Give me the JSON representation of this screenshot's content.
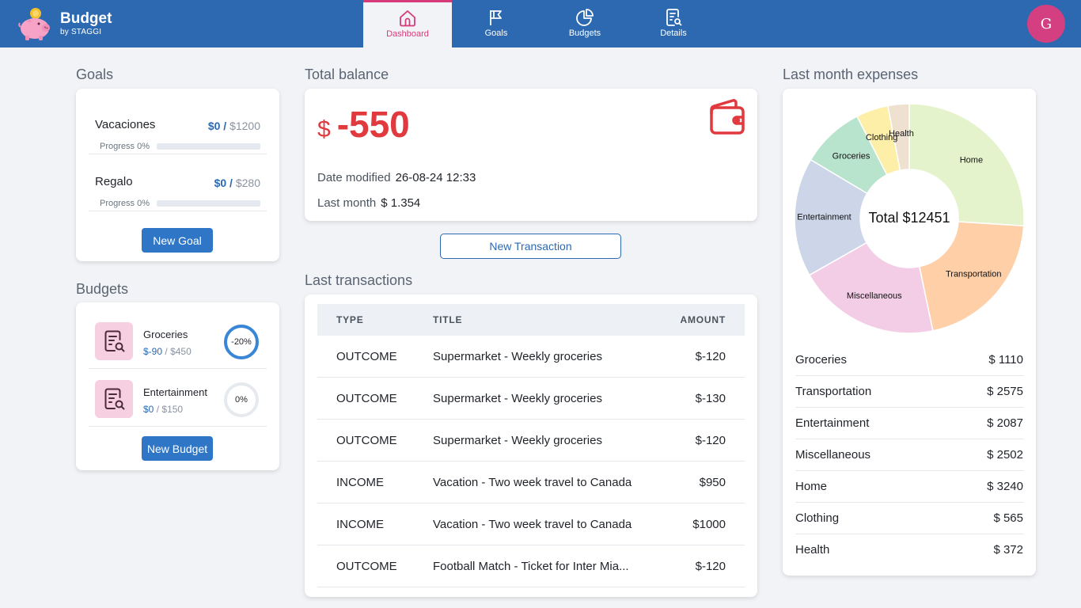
{
  "app": {
    "title": "Budget",
    "subtitle": "by STAGGI"
  },
  "nav": [
    {
      "label": "Dashboard",
      "icon": "home-icon",
      "active": true
    },
    {
      "label": "Goals",
      "icon": "flag-icon",
      "active": false
    },
    {
      "label": "Budgets",
      "icon": "pie-icon",
      "active": false
    },
    {
      "label": "Details",
      "icon": "document-search-icon",
      "active": false
    }
  ],
  "user": {
    "initial": "G"
  },
  "goals": {
    "title": "Goals",
    "items": [
      {
        "name": "Vacaciones",
        "current": "$0 /",
        "target": "$1200",
        "progress_label": "Progress 0%",
        "progress": 0
      },
      {
        "name": "Regalo",
        "current": "$0 /",
        "target": "$280",
        "progress_label": "Progress 0%",
        "progress": 0
      }
    ],
    "new_button": "New Goal"
  },
  "budgets": {
    "title": "Budgets",
    "items": [
      {
        "name": "Groceries",
        "spent": "$-90",
        "sep": "/",
        "limit": "$450",
        "percent_label": "-20%",
        "percent": -20
      },
      {
        "name": "Entertainment",
        "spent": "$0",
        "sep": "/",
        "limit": "$150",
        "percent_label": "0%",
        "percent": 0
      }
    ],
    "new_button": "New Budget"
  },
  "balance": {
    "title": "Total balance",
    "currency": "$",
    "value": "-550",
    "date_label": "Date modified",
    "date_value": "26-08-24 12:33",
    "last_month_label": "Last month",
    "last_month_value": "$ 1.354"
  },
  "new_transaction_button": "New Transaction",
  "transactions": {
    "title": "Last transactions",
    "headers": {
      "type": "TYPE",
      "title": "TITLE",
      "amount": "AMOUNT"
    },
    "rows": [
      {
        "type": "OUTCOME",
        "title": "Supermarket - Weekly groceries",
        "amount": "$-120"
      },
      {
        "type": "OUTCOME",
        "title": "Supermarket - Weekly groceries",
        "amount": "$-130"
      },
      {
        "type": "OUTCOME",
        "title": "Supermarket - Weekly groceries",
        "amount": "$-120"
      },
      {
        "type": "INCOME",
        "title": "Vacation - Two week travel to Canada",
        "amount": "$950"
      },
      {
        "type": "INCOME",
        "title": "Vacation - Two week travel to Canada",
        "amount": "$1000"
      },
      {
        "type": "OUTCOME",
        "title": "Football Match - Ticket for Inter Mia...",
        "amount": "$-120"
      }
    ]
  },
  "expenses": {
    "title": "Last month expenses",
    "rows": [
      {
        "name": "Groceries",
        "amount": "$ 1110"
      },
      {
        "name": "Transportation",
        "amount": "$ 2575"
      },
      {
        "name": "Entertainment",
        "amount": "$ 2087"
      },
      {
        "name": "Miscellaneous",
        "amount": "$ 2502"
      },
      {
        "name": "Home",
        "amount": "$ 3240"
      },
      {
        "name": "Clothing",
        "amount": "$ 565"
      },
      {
        "name": "Health",
        "amount": "$ 372"
      }
    ]
  },
  "chart_data": {
    "type": "pie",
    "variant": "doughnut",
    "center_label": "Total $12451",
    "categories": [
      "Home",
      "Transportation",
      "Miscellaneous",
      "Entertainment",
      "Groceries",
      "Clothing",
      "Health"
    ],
    "values": [
      3240,
      2575,
      2502,
      2087,
      1110,
      565,
      372
    ],
    "colors": [
      "#e5f3cc",
      "#ffcfa8",
      "#f3cde6",
      "#ccd6e8",
      "#b8e3cc",
      "#fdefa8",
      "#efe1d0"
    ]
  },
  "colors": {
    "topbar": "#2d69b0",
    "accent_pink": "#d63a7a",
    "primary": "#2f76c6",
    "negative": "#e0393e"
  }
}
